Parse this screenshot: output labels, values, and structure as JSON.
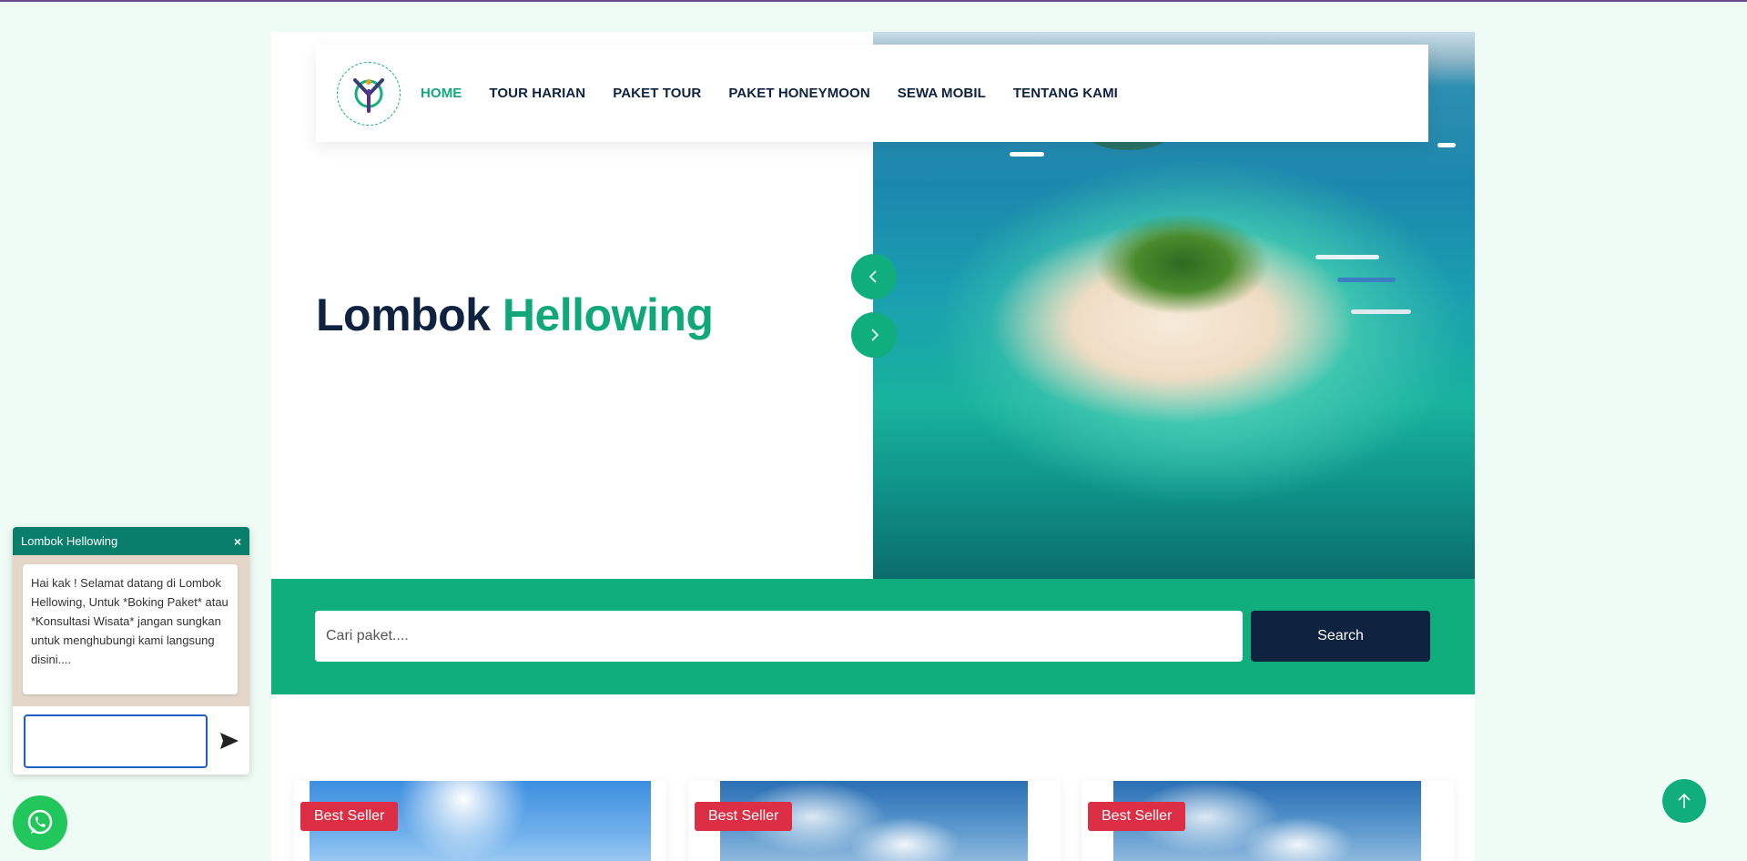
{
  "nav": {
    "logo_alt": "Lombok Hellowing logo",
    "items": [
      {
        "label": "HOME",
        "active": true
      },
      {
        "label": "TOUR HARIAN",
        "active": false
      },
      {
        "label": "PAKET TOUR",
        "active": false
      },
      {
        "label": "PAKET HONEYMOON",
        "active": false
      },
      {
        "label": "SEWA MOBIL",
        "active": false
      },
      {
        "label": "TENTANG KAMI",
        "active": false
      }
    ]
  },
  "hero": {
    "title_main": "Lombok",
    "title_accent": "Hellowing",
    "prev_icon": "chevron-left-icon",
    "next_icon": "chevron-right-icon"
  },
  "search": {
    "placeholder": "Cari paket....",
    "button_label": "Search"
  },
  "cards": [
    {
      "badge": "Best Seller"
    },
    {
      "badge": "Best Seller"
    },
    {
      "badge": "Best Seller"
    }
  ],
  "chat": {
    "title": "Lombok Hellowing",
    "close_label": "×",
    "message": "Hai kak ! Selamat datang di Lombok Hellowing, Untuk *Boking Paket* atau *Konsultasi Wisata* jangan sungkan untuk menghubungi kami langsung disini....",
    "input_value": ""
  },
  "colors": {
    "accent": "#0fae7c",
    "navy": "#0f2340",
    "badge": "#dc2f45",
    "chat_header": "#087e6b",
    "whatsapp": "#21c75b"
  }
}
